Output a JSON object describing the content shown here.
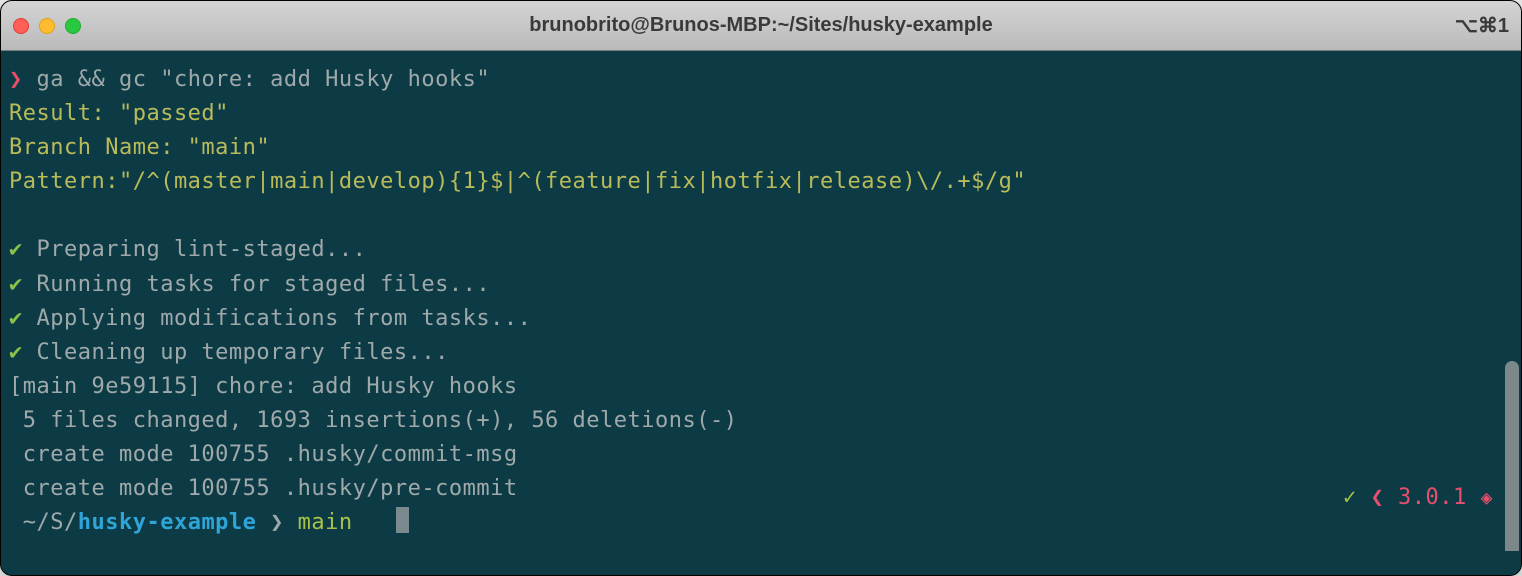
{
  "window": {
    "title": "brunobrito@Brunos-MBP:~/Sites/husky-example",
    "shortcut": "⌥⌘1"
  },
  "command": "ga && gc \"chore: add Husky hooks\"",
  "result_line": "Result: \"passed\"",
  "branch_line": "Branch Name: \"main\"",
  "pattern_line": "Pattern:\"/^(master|main|develop){1}$|^(feature|fix|hotfix|release)\\/.+$/g\"",
  "tasks": [
    "Preparing lint-staged...",
    "Running tasks for staged files...",
    "Applying modifications from tasks...",
    "Cleaning up temporary files..."
  ],
  "commit_line": "[main 9e59115] chore: add Husky hooks",
  "changes_line": " 5 files changed, 1693 insertions(+), 56 deletions(-)",
  "create_lines": [
    " create mode 100755 .husky/commit-msg",
    " create mode 100755 .husky/pre-commit"
  ],
  "prompt": {
    "path_prefix": " ~/S/",
    "dir": "husky-example",
    "branch": "main"
  },
  "status": {
    "check": "✓",
    "version": "3.0.1"
  }
}
